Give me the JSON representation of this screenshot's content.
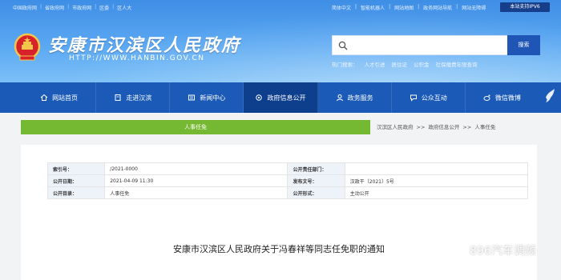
{
  "top_links": [
    "中国政府网",
    "省政府网",
    "市政府网",
    "区委",
    "区人大"
  ],
  "top_right_links": [
    "简体中文",
    "智能机器人",
    "网站地图",
    "政务网站导航",
    "网站无障碍"
  ],
  "ipv6_label": "本站支持IPV6",
  "site": {
    "title": "安康市汉滨区人民政府",
    "url": "HTTP://WWW.HANBIN.GOV.CN"
  },
  "search": {
    "placeholder": "",
    "button": "搜索"
  },
  "hotwords": {
    "label": "热门搜索：",
    "items": [
      "人才引进",
      "居住证",
      "公积金",
      "社保缴费年限查询"
    ]
  },
  "nav": [
    {
      "label": "网站首页",
      "icon": "home-icon"
    },
    {
      "label": "走进汉滨",
      "icon": "book-icon"
    },
    {
      "label": "新闻中心",
      "icon": "news-icon"
    },
    {
      "label": "政府信息公开",
      "icon": "gear-icon",
      "active": true
    },
    {
      "label": "政务服务",
      "icon": "user-icon"
    },
    {
      "label": "公众互动",
      "icon": "chat-icon"
    },
    {
      "label": "微信微博",
      "icon": "weibo-icon"
    }
  ],
  "section_title": "人事任免",
  "breadcrumb": [
    "汉滨区人民政府",
    ">>",
    "政府信息公开",
    ">>",
    "人事任免"
  ],
  "meta": {
    "index_label": "索引号：",
    "index_value": "/2021-0000",
    "dept_label": "公开责任部门：",
    "dept_value": "",
    "date_label": "公开日期：",
    "date_value": "2021-04-09 11:30",
    "docno_label": "发布文号：",
    "docno_value": "汉政干〔2021〕5号",
    "category_label": "公开目录：",
    "category_value": "人事任免",
    "form_label": "公开形式：",
    "form_value": "主动公开"
  },
  "doc_title": "安康市汉滨区人民政府关于冯春祥等同志任免职的通知",
  "watermark": "896汽车调频"
}
